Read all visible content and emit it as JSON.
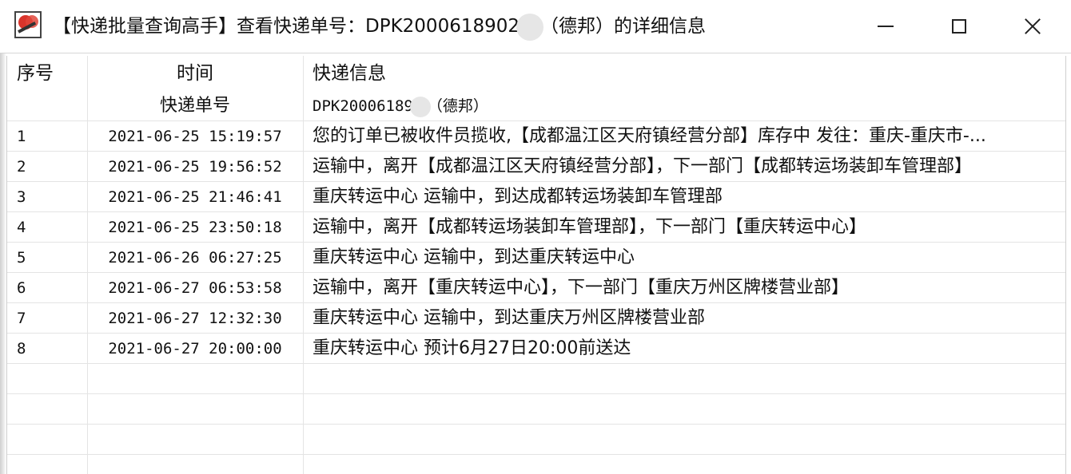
{
  "window": {
    "title_prefix": "【快递批量查询高手】查看快递单号：DPK2000618902",
    "title_suffix": "（德邦）的详细信息"
  },
  "columns": {
    "index": "序号",
    "time": "时间",
    "info": "快递信息"
  },
  "subheader": {
    "label": "快递单号",
    "tracking_prefix": "DPK20006189",
    "tracking_suffix": "（德邦）"
  },
  "rows": [
    {
      "no": "1",
      "time": "2021-06-25 15:19:57",
      "info": "您的订单已被收件员揽收,【成都温江区天府镇经营分部】库存中 发往：重庆-重庆市-..."
    },
    {
      "no": "2",
      "time": "2021-06-25 19:56:52",
      "info": "运输中，离开【成都温江区天府镇经营分部】，下一部门【成都转运场装卸车管理部】"
    },
    {
      "no": "3",
      "time": "2021-06-25 21:46:41",
      "info": "重庆转运中心 运输中，到达成都转运场装卸车管理部"
    },
    {
      "no": "4",
      "time": "2021-06-25 23:50:18",
      "info": "运输中，离开【成都转运场装卸车管理部】，下一部门【重庆转运中心】"
    },
    {
      "no": "5",
      "time": "2021-06-26 06:27:25",
      "info": "重庆转运中心 运输中，到达重庆转运中心"
    },
    {
      "no": "6",
      "time": "2021-06-27 06:53:58",
      "info": "运输中，离开【重庆转运中心】，下一部门【重庆万州区牌楼营业部】"
    },
    {
      "no": "7",
      "time": "2021-06-27 12:32:30",
      "info": "重庆转运中心 运输中，到达重庆万州区牌楼营业部"
    },
    {
      "no": "8",
      "time": "2021-06-27 20:00:00",
      "info": "重庆转运中心 预计6月27日20:00前送达"
    }
  ]
}
